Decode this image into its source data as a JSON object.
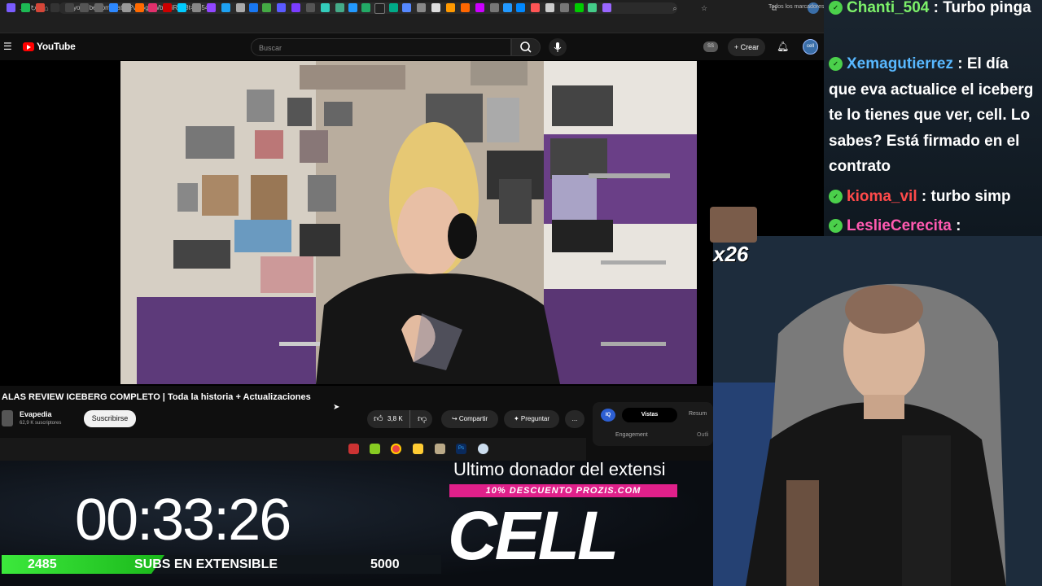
{
  "browser": {
    "url": "youtube.com/watch?v=GgwWbD4iR808t=35543s",
    "bookmarks_folder": "Todos los marcadores"
  },
  "youtube": {
    "logo_text": "YouTube",
    "search_placeholder": "Buscar",
    "ss_badge": "SS",
    "create_label": "Crear",
    "avatar_text": "cell"
  },
  "video": {
    "title": "ALAS REVIEW ICEBERG COMPLETO | Toda la historia + Actualizaciones",
    "channel_name": "Evapedia",
    "channel_subs": "62,9 K suscriptores",
    "subscribe_label": "Suscribirse",
    "likes": "3,8 K",
    "share_label": "Compartir",
    "ask_label": "Preguntar",
    "more_label": "..."
  },
  "side_panel": {
    "iq": "IQ",
    "tab_active": "Vistas",
    "tab_other": "Resum",
    "label_engagement": "Engagement",
    "label_outliers": "Outli"
  },
  "overlay": {
    "timer": "00:33:26",
    "progress_current": "2485",
    "progress_label": "SUBS EN EXTENSIBLE",
    "progress_goal": "5000",
    "progress_fraction": 0.497,
    "donor_text": "Ultimo donador del extensi",
    "promo_text": "10% DESCUENTO PROZIS.COM",
    "brand_logo": "CELL",
    "emote_count": "x26"
  },
  "chat": {
    "messages": [
      {
        "user": "Chanti_504",
        "color": "#7cf06a",
        "text": "Turbo pinga"
      },
      {
        "user": "Xemagutierrez",
        "color": "#58b8ff",
        "text": "El día que eva actualice el iceberg te lo tienes que ver, cell. Lo sabes? Está firmado en el contrato"
      },
      {
        "user": "kioma_vil",
        "color": "#ff4a4a",
        "text": "turbo simp"
      },
      {
        "user": "LeslieCerecita",
        "color": "#ff5ab0",
        "text": ""
      }
    ]
  },
  "colors": {
    "youtube_red": "#ff0000",
    "progress_green": "#3ce83c",
    "promo_pink": "#e0208a",
    "chat_badge": "#4bd04b"
  }
}
